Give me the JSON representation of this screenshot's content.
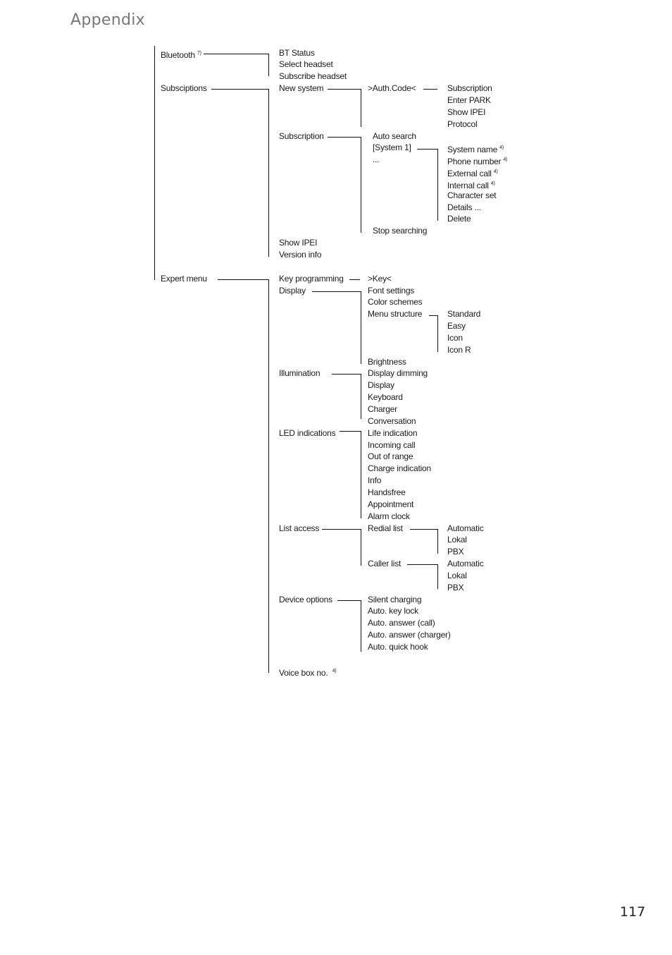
{
  "page": {
    "title": "Appendix",
    "page_number": "117"
  },
  "menu": {
    "bluetooth": {
      "label": "Bluetooth",
      "note": "7)",
      "items": [
        "BT Status",
        "Select headset",
        "Subscribe headset"
      ]
    },
    "subscriptions": {
      "label": "Subsciptions",
      "new_system": {
        "label": "New system",
        "auth": ">Auth.Code<",
        "items": [
          "Subscription",
          "Enter PARK",
          "Show IPEI",
          "Protocol"
        ]
      },
      "subscription": {
        "label": "Subscription",
        "items": [
          "Auto search",
          "[System 1]",
          "...",
          "Stop searching"
        ],
        "system_items": [
          {
            "label": "System name",
            "note": "4)"
          },
          {
            "label": "Phone number",
            "note": "4)"
          },
          {
            "label": "External call",
            "note": "4)"
          },
          {
            "label": "Internal call",
            "note": "4)"
          },
          {
            "label": "Character set",
            "note": ""
          },
          {
            "label": "Details ...",
            "note": ""
          },
          {
            "label": "Delete",
            "note": ""
          }
        ]
      },
      "show_ipei": "Show IPEI",
      "version_info": "Version info"
    },
    "expert": {
      "label": "Expert menu",
      "key_programming": {
        "label": "Key programming",
        "key": ">Key<"
      },
      "display": {
        "label": "Display",
        "items": [
          "Font settings",
          "Color schemes",
          "Menu structure",
          "Brightness"
        ],
        "menu_structure": [
          "Standard",
          "Easy",
          "Icon",
          "Icon R"
        ]
      },
      "illumination": {
        "label": "Illumination",
        "items": [
          "Display dimming",
          "Display",
          "Keyboard",
          "Charger",
          "Conversation"
        ]
      },
      "led": {
        "label": "LED indications",
        "items": [
          "Life indication",
          "Incoming call",
          "Out of range",
          "Charge indication",
          "Info",
          "Handsfree",
          "Appointment",
          "Alarm clock"
        ]
      },
      "list_access": {
        "label": "List access",
        "redial": {
          "label": "Redial list",
          "items": [
            "Automatic",
            "Lokal",
            "PBX"
          ]
        },
        "caller": {
          "label": "Caller list",
          "items": [
            "Automatic",
            "Lokal",
            "PBX"
          ]
        }
      },
      "device_options": {
        "label": "Device options",
        "items": [
          "Silent charging",
          "Auto. key lock",
          "Auto. answer (call)",
          "Auto. answer (charger)",
          "Auto. quick hook"
        ]
      },
      "voice_box": {
        "label": "Voice box no.",
        "note": "4)"
      }
    }
  }
}
